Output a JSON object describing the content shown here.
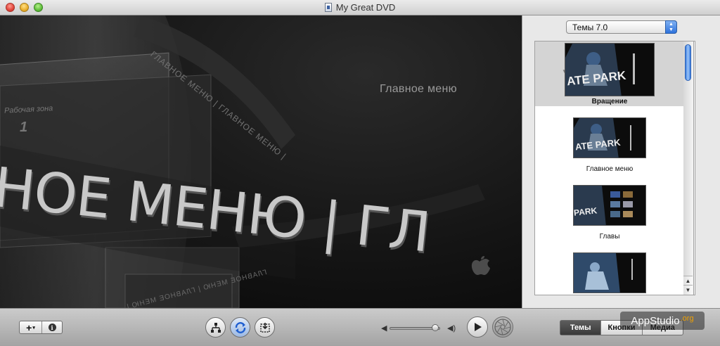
{
  "window": {
    "title": "My Great DVD"
  },
  "preview": {
    "menu_title": "Главное меню",
    "workzone_label": "Рабочая зона",
    "workzone_number": "1",
    "big_text": "НОЕ МЕНЮ | ГЛ",
    "ring_text": "ГЛАВНОЕ МЕНЮ | ГЛАВНОЕ МЕНЮ |",
    "ring_text_upper": "ГЛАВНОЕ МЕНЮ | ГЛАВНОЕ МЕНЮ |",
    "thumb_caption": "ГЛАВНОЕ МЕНЮ"
  },
  "panel": {
    "theme_select": "Темы 7.0",
    "themes": [
      {
        "label": "Вращение",
        "selected": true,
        "thumb_text": "ATE PARK"
      },
      {
        "label": "Главное меню",
        "selected": false,
        "thumb_text": "ATE PARK"
      },
      {
        "label": "Главы",
        "selected": false,
        "thumb_text": "PARK"
      },
      {
        "label": "",
        "selected": false,
        "thumb_text": ""
      }
    ]
  },
  "toolbar": {
    "add_label": "+",
    "info_label": "i",
    "tabs": [
      {
        "label": "Темы",
        "active": true
      },
      {
        "label": "Кнопки",
        "active": false
      },
      {
        "label": "Медиа",
        "active": false
      }
    ],
    "volume_level": 0.9
  },
  "watermark": {
    "main": "AppStudio",
    "suffix": ".org"
  },
  "colors": {
    "accent": "#2f73dc",
    "preview_bg": "#0a0a0a",
    "active_tab": "#3a3a3a"
  }
}
